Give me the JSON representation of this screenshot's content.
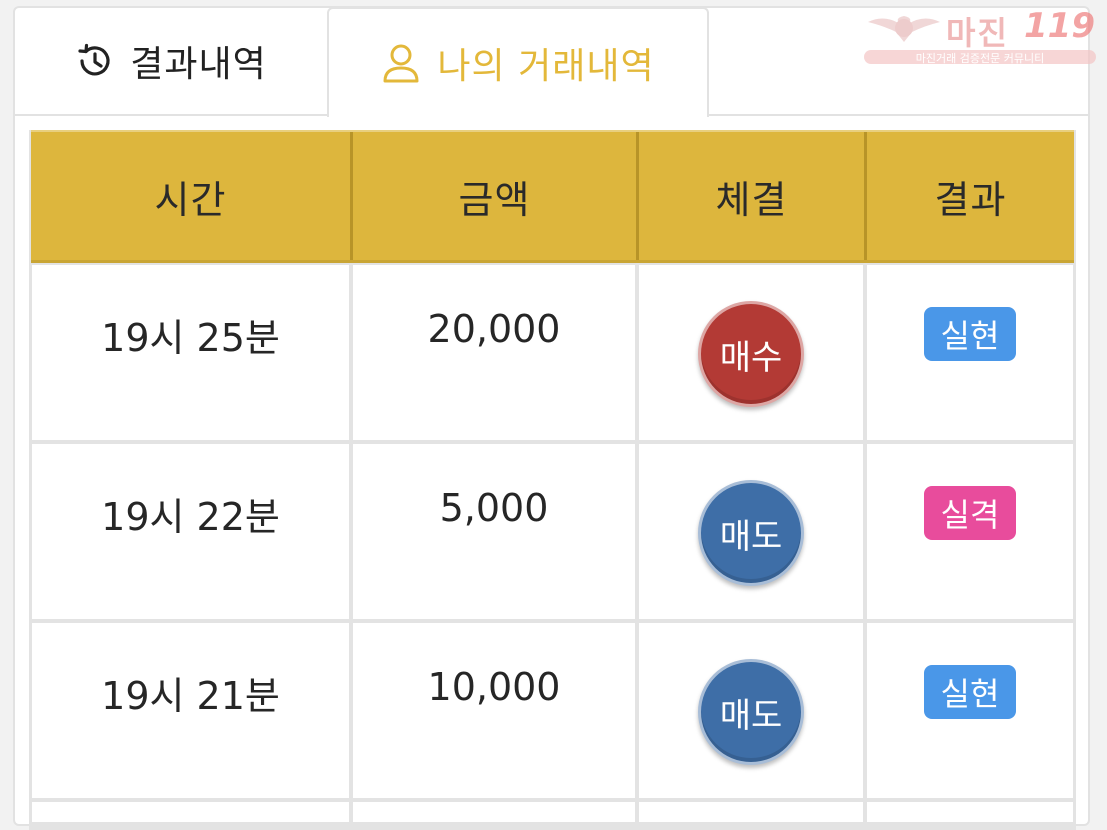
{
  "tabs": [
    {
      "label": "결과내역",
      "icon": "history-icon",
      "active": false
    },
    {
      "label": "나의 거래내역",
      "icon": "user-icon",
      "active": true
    }
  ],
  "watermark": {
    "title": "마진",
    "number": "119",
    "subtitle": "마진거래 검증전문 커뮤니티"
  },
  "table": {
    "headers": [
      "시간",
      "금액",
      "체결",
      "결과"
    ],
    "rows": [
      {
        "time": "19시 25분",
        "amount": "20,000",
        "trade": "매수",
        "trade_color": "#b33a35",
        "result": "실현",
        "result_color": "#4a97e8"
      },
      {
        "time": "19시 22분",
        "amount": "5,000",
        "trade": "매도",
        "trade_color": "#3e6ea7",
        "result": "실격",
        "result_color": "#e84c9c"
      },
      {
        "time": "19시 21분",
        "amount": "10,000",
        "trade": "매도",
        "trade_color": "#3e6ea7",
        "result": "실현",
        "result_color": "#4a97e8"
      }
    ]
  },
  "colors": {
    "header_bg": "#ddb63d",
    "active_tab": "#e3b83a"
  }
}
